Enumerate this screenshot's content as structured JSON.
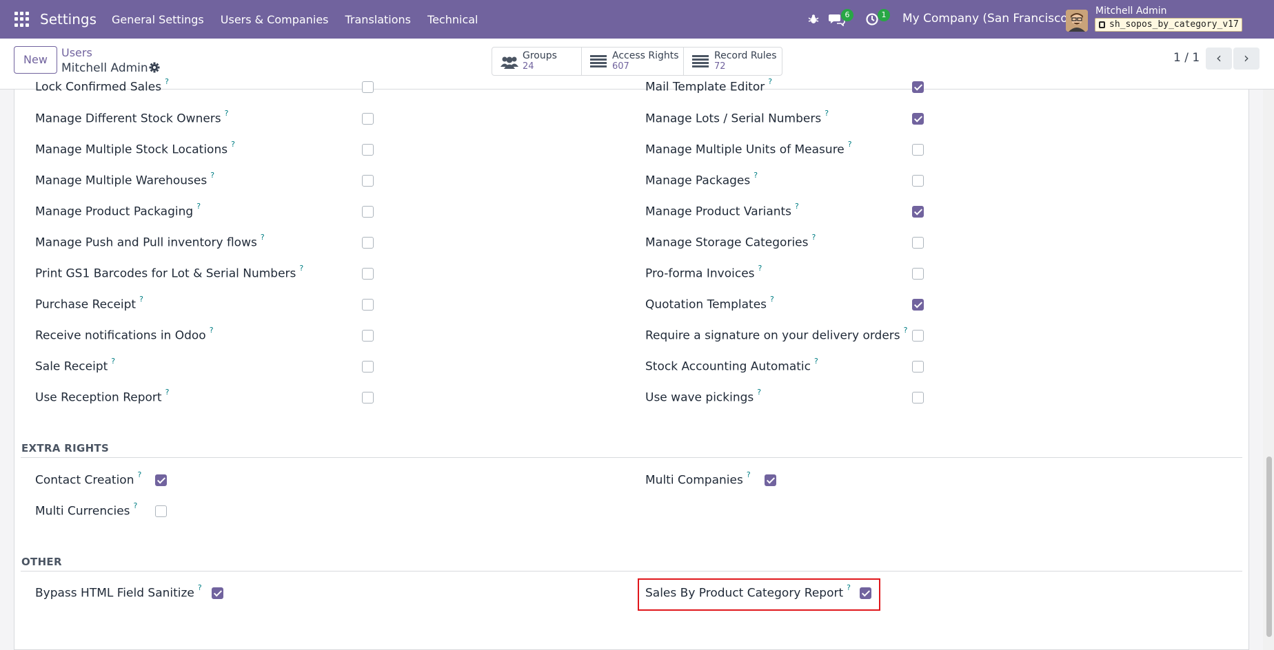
{
  "navbar": {
    "brand": "Settings",
    "menu": [
      "General Settings",
      "Users & Companies",
      "Translations",
      "Technical"
    ],
    "messages_count": "6",
    "activities_count": "1",
    "company": "My Company (San Francisco)",
    "user_name": "Mitchell Admin",
    "database": "sh_sopos_by_category_v17"
  },
  "control": {
    "new_label": "New",
    "breadcrumb_parent": "Users",
    "breadcrumb_current": "Mitchell Admin",
    "smart_buttons": [
      {
        "label": "Groups",
        "value": "24",
        "icon": "users-icon"
      },
      {
        "label": "Access Rights",
        "value": "607",
        "icon": "list-icon"
      },
      {
        "label": "Record Rules",
        "value": "72",
        "icon": "list-icon"
      }
    ],
    "pager": "1 / 1"
  },
  "rights_left": [
    {
      "label": "Lock Confirmed Sales",
      "checked": false
    },
    {
      "label": "Manage Different Stock Owners",
      "checked": false
    },
    {
      "label": "Manage Multiple Stock Locations",
      "checked": false
    },
    {
      "label": "Manage Multiple Warehouses",
      "checked": false
    },
    {
      "label": "Manage Product Packaging",
      "checked": false
    },
    {
      "label": "Manage Push and Pull inventory flows",
      "checked": false
    },
    {
      "label": "Print GS1 Barcodes for Lot & Serial Numbers",
      "checked": false
    },
    {
      "label": "Purchase Receipt",
      "checked": false
    },
    {
      "label": "Receive notifications in Odoo",
      "checked": false
    },
    {
      "label": "Sale Receipt",
      "checked": false
    },
    {
      "label": "Use Reception Report",
      "checked": false
    }
  ],
  "rights_right": [
    {
      "label": "Mail Template Editor",
      "checked": true
    },
    {
      "label": "Manage Lots / Serial Numbers",
      "checked": true
    },
    {
      "label": "Manage Multiple Units of Measure",
      "checked": false
    },
    {
      "label": "Manage Packages",
      "checked": false
    },
    {
      "label": "Manage Product Variants",
      "checked": true
    },
    {
      "label": "Manage Storage Categories",
      "checked": false
    },
    {
      "label": "Pro-forma Invoices",
      "checked": false
    },
    {
      "label": "Quotation Templates",
      "checked": true
    },
    {
      "label": "Require a signature on your delivery orders",
      "checked": false
    },
    {
      "label": "Stock Accounting Automatic",
      "checked": false
    },
    {
      "label": "Use wave pickings",
      "checked": false
    }
  ],
  "extra_rights": {
    "title": "EXTRA RIGHTS",
    "items": [
      {
        "label": "Contact Creation",
        "checked": true
      },
      {
        "label": "Multi Companies",
        "checked": true
      },
      {
        "label": "Multi Currencies",
        "checked": false
      }
    ]
  },
  "other": {
    "title": "OTHER",
    "items": [
      {
        "label": "Bypass HTML Field Sanitize",
        "checked": true
      },
      {
        "label": "Sales By Product Category Report",
        "checked": true
      }
    ]
  },
  "help_marker": "?",
  "colors": {
    "accent": "#71639e",
    "highlight": "#e0161b",
    "help": "#017e84"
  }
}
